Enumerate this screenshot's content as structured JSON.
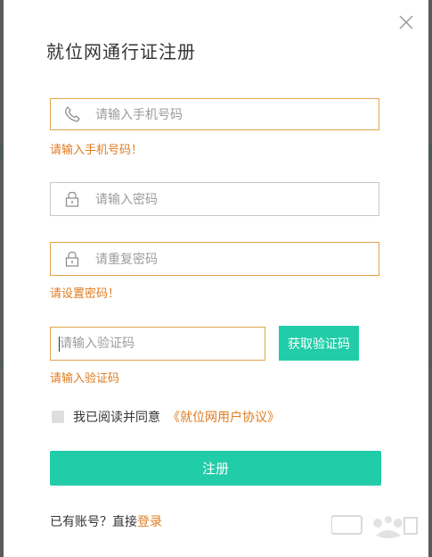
{
  "dialog": {
    "title": "就位网通行证注册"
  },
  "phone": {
    "placeholder": "请输入手机号码",
    "icon": "phone-icon",
    "error": "请输入手机号码！"
  },
  "password": {
    "placeholder": "请输入密码",
    "icon": "lock-icon"
  },
  "confirm_password": {
    "placeholder": "请重复密码",
    "icon": "lock-icon",
    "error": "请设置密码！"
  },
  "verify_code": {
    "placeholder": "请输入验证码",
    "button_label": "获取验证码",
    "error": "请输入验证码"
  },
  "agreement": {
    "text": "我已阅读并同意",
    "link_text": "《就位网用户协议》",
    "checked": false
  },
  "submit": {
    "label": "注册"
  },
  "login": {
    "prompt": "已有账号？直接",
    "link_text": "登录"
  },
  "colors": {
    "accent": "#21cda8",
    "warning": "#e07b1f",
    "warning_border": "#e0a44c"
  }
}
